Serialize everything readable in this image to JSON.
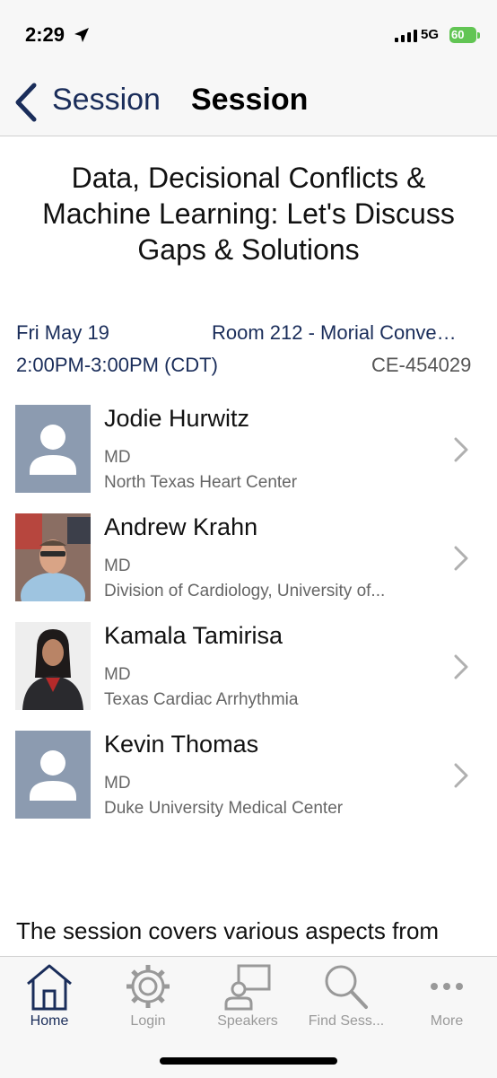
{
  "status_bar": {
    "time": "2:29",
    "network": "5G",
    "battery": "60"
  },
  "nav": {
    "back_label": "Session",
    "title": "Session"
  },
  "session": {
    "title": "Data, Decisional Conflicts & Machine Learning: Let's Discuss Gaps & Solutions",
    "date": "Fri May 19",
    "time": "2:00PM-3:00PM (CDT)",
    "room": "Room 212 - Morial Conve…",
    "code": "CE-454029"
  },
  "speakers": [
    {
      "name": "Jodie Hurwitz",
      "credentials": "MD",
      "organization": "North Texas Heart Center",
      "photo": "placeholder"
    },
    {
      "name": "Andrew Krahn",
      "credentials": "MD",
      "organization": "Division of Cardiology, University of...",
      "photo": "photo"
    },
    {
      "name": "Kamala Tamirisa",
      "credentials": "MD",
      "organization": "Texas Cardiac Arrhythmia",
      "photo": "photo"
    },
    {
      "name": "Kevin Thomas",
      "credentials": "MD",
      "organization": "Duke University Medical Center",
      "photo": "placeholder"
    }
  ],
  "description": "The session covers various aspects from",
  "tabs": [
    {
      "label": "Home",
      "icon": "home-icon",
      "active": true
    },
    {
      "label": "Login",
      "icon": "gear-icon",
      "active": false
    },
    {
      "label": "Speakers",
      "icon": "speaker-icon",
      "active": false
    },
    {
      "label": "Find Sess...",
      "icon": "search-icon",
      "active": false
    },
    {
      "label": "More",
      "icon": "more-icon",
      "active": false
    }
  ],
  "colors": {
    "accent": "#1a2d5a",
    "inactive": "#999999",
    "avatar_placeholder": "#8c9bb0",
    "battery": "#62c554"
  }
}
